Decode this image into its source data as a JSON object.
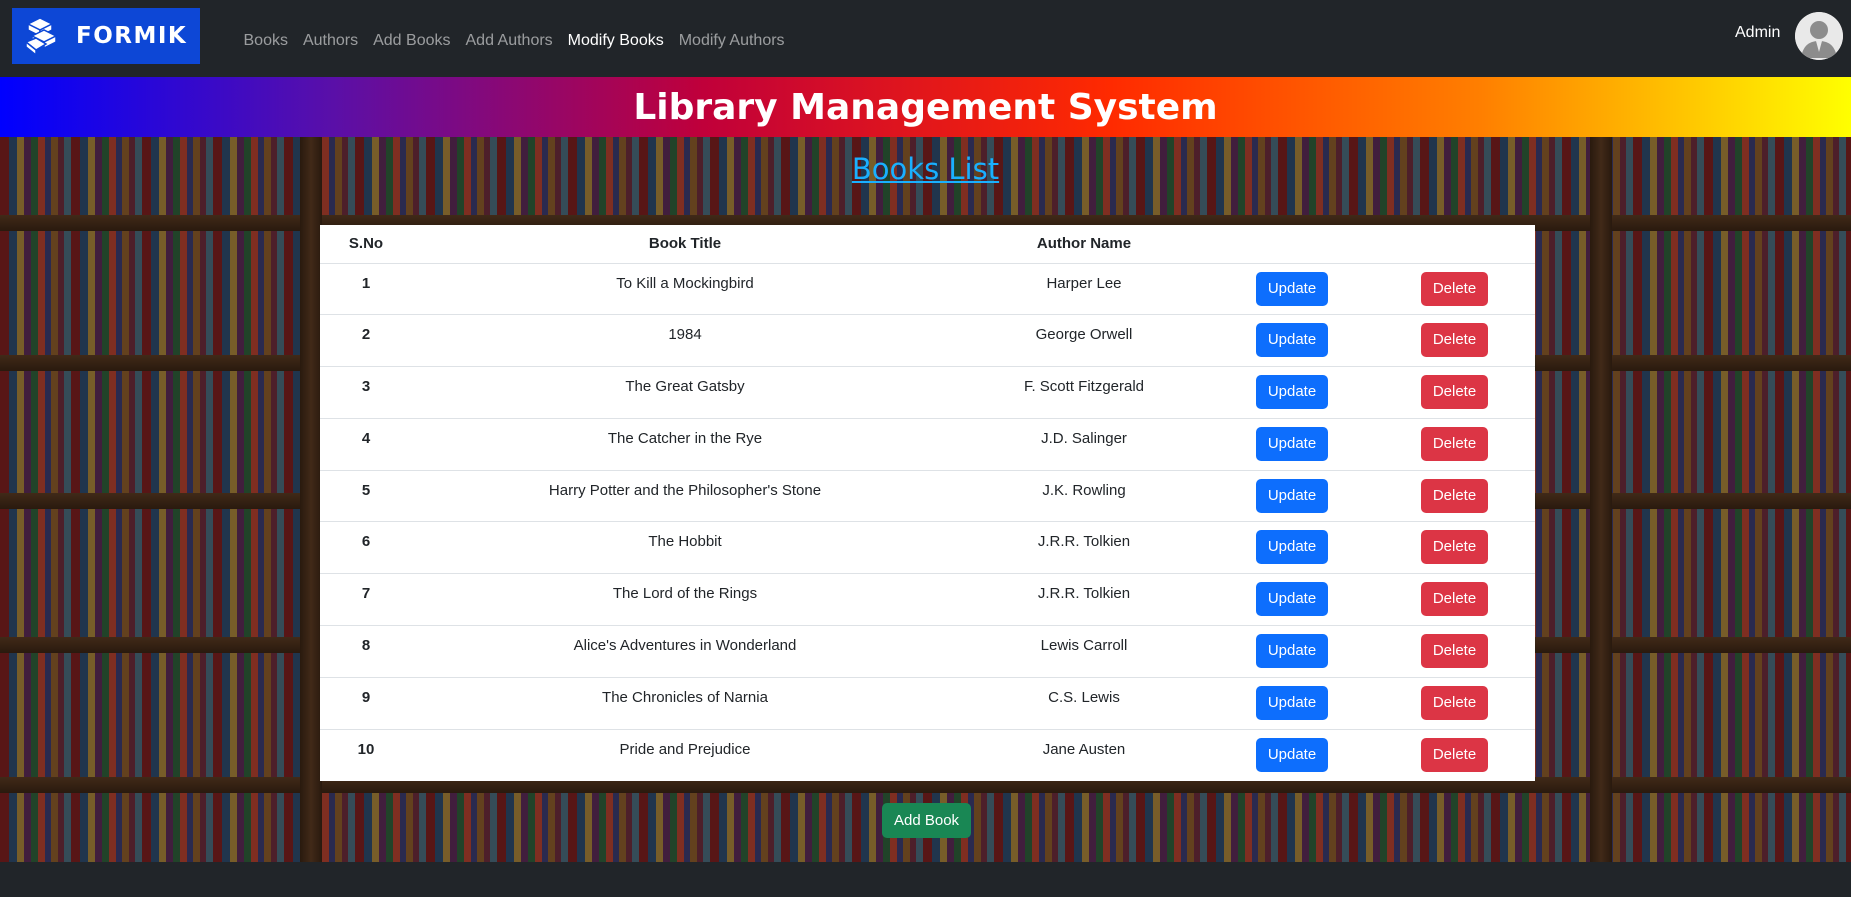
{
  "brand": {
    "name": "FORMIK",
    "logo_color": "#0d47d6"
  },
  "nav": {
    "items": [
      {
        "label": "Books",
        "active": false
      },
      {
        "label": "Authors",
        "active": false
      },
      {
        "label": "Add Books",
        "active": false
      },
      {
        "label": "Add Authors",
        "active": false
      },
      {
        "label": "Modify Books",
        "active": true
      },
      {
        "label": "Modify Authors",
        "active": false
      }
    ]
  },
  "user": {
    "name": "Admin",
    "avatar_icon": "user-avatar-icon"
  },
  "banner": {
    "title": "Library Management System"
  },
  "list": {
    "title": "Books List"
  },
  "table": {
    "headers": {
      "sno": "S.No",
      "title": "Book Title",
      "author": "Author Name"
    },
    "update_label": "Update",
    "delete_label": "Delete",
    "rows": [
      {
        "sno": "1",
        "title": "To Kill a Mockingbird",
        "author": "Harper Lee"
      },
      {
        "sno": "2",
        "title": "1984",
        "author": "George Orwell"
      },
      {
        "sno": "3",
        "title": "The Great Gatsby",
        "author": "F. Scott Fitzgerald"
      },
      {
        "sno": "4",
        "title": "The Catcher in the Rye",
        "author": "J.D. Salinger"
      },
      {
        "sno": "5",
        "title": "Harry Potter and the Philosopher's Stone",
        "author": "J.K. Rowling"
      },
      {
        "sno": "6",
        "title": "The Hobbit",
        "author": "J.R.R. Tolkien"
      },
      {
        "sno": "7",
        "title": "The Lord of the Rings",
        "author": "J.R.R. Tolkien"
      },
      {
        "sno": "8",
        "title": "Alice's Adventures in Wonderland",
        "author": "Lewis Carroll"
      },
      {
        "sno": "9",
        "title": "The Chronicles of Narnia",
        "author": "C.S. Lewis"
      },
      {
        "sno": "10",
        "title": "Pride and Prejudice",
        "author": "Jane Austen"
      }
    ]
  },
  "actions": {
    "add_book_label": "Add Book"
  },
  "colors": {
    "navbar": "#212529",
    "update": "#0d6efd",
    "delete": "#dc3545",
    "add": "#198754",
    "link": "#1ab0ff"
  }
}
